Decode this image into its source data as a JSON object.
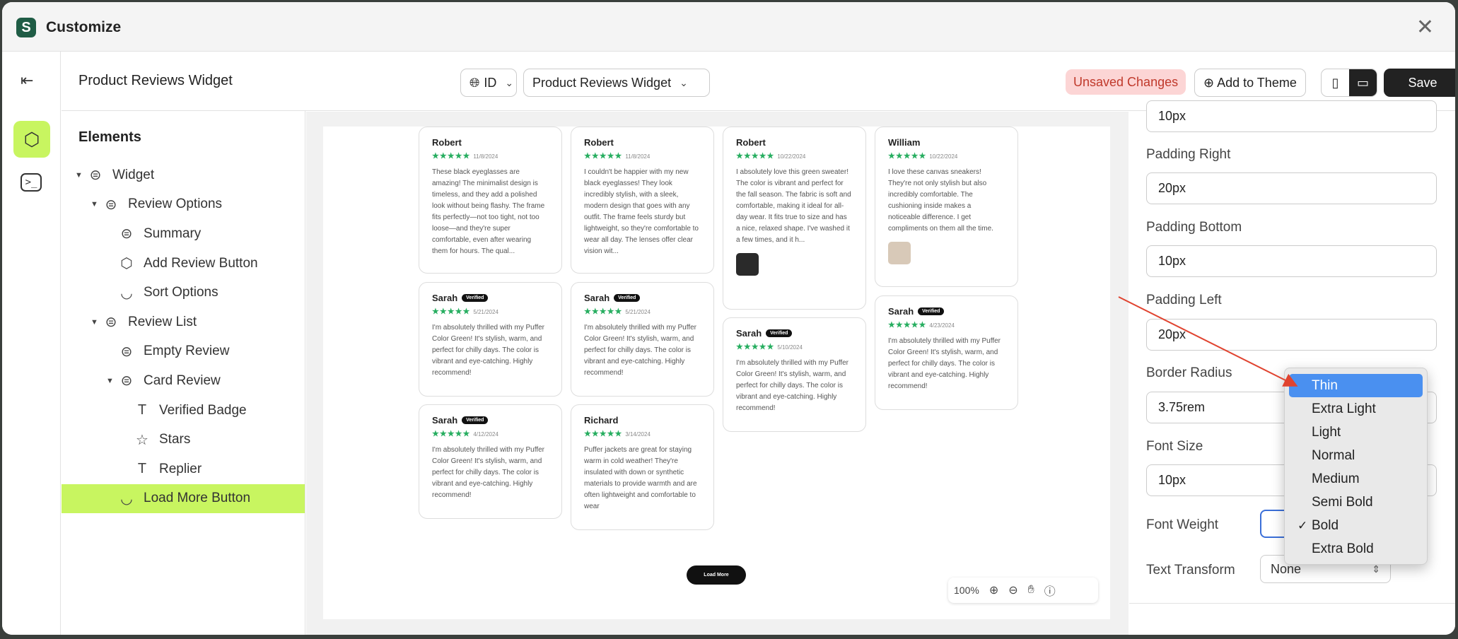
{
  "window": {
    "title": "Customize",
    "logo": "S"
  },
  "topbar": {
    "page_title": "Product Reviews Widget",
    "lang": "ID",
    "template": "Product Reviews Widget",
    "unsaved": "Unsaved Changes",
    "add_to_theme": "Add to Theme",
    "save": "Save"
  },
  "elements": {
    "heading": "Elements",
    "items": [
      {
        "label": "Widget"
      },
      {
        "label": "Review Options"
      },
      {
        "label": "Summary"
      },
      {
        "label": "Add Review Button"
      },
      {
        "label": "Sort Options"
      },
      {
        "label": "Review List"
      },
      {
        "label": "Empty Review"
      },
      {
        "label": "Card Review"
      },
      {
        "label": "Verified Badge"
      },
      {
        "label": "Stars"
      },
      {
        "label": "Replier"
      },
      {
        "label": "Load More Button"
      }
    ]
  },
  "canvas": {
    "verified": "Verified",
    "load_more": "Load More",
    "zoom": "100%",
    "cards": [
      {
        "name": "Robert",
        "date": "11/8/2024",
        "text": "These black eyeglasses are amazing! The minimalist design is timeless, and they add a polished look without being flashy. The frame fits perfectly—not too tight, not too loose—and they're super comfortable, even after wearing them for hours. The qual..."
      },
      {
        "name": "Robert",
        "date": "11/8/2024",
        "text": "I couldn't be happier with my new black eyeglasses! They look incredibly stylish, with a sleek, modern design that goes with any outfit. The frame feels sturdy but lightweight, so they're comfortable to wear all day. The lenses offer clear vision wit..."
      },
      {
        "name": "Robert",
        "date": "10/22/2024",
        "text": "I absolutely love this green sweater! The color is vibrant and perfect for the fall season. The fabric is soft and comfortable, making it ideal for all-day wear. It fits true to size and has a nice, relaxed shape. I've washed it a few times, and it h..."
      },
      {
        "name": "William",
        "date": "10/22/2024",
        "text": "I love these canvas sneakers! They're not only stylish but also incredibly comfortable. The cushioning inside makes a noticeable difference. I get compliments on them all the time."
      },
      {
        "name": "Sarah",
        "date": "5/21/2024",
        "text": "I'm absolutely thrilled with my Puffer Color Green! It's stylish, warm, and perfect for chilly days. The color is vibrant and eye-catching. Highly recommend!"
      },
      {
        "name": "Sarah",
        "date": "5/21/2024",
        "text": "I'm absolutely thrilled with my Puffer Color Green! It's stylish, warm, and perfect for chilly days. The color is vibrant and eye-catching. Highly recommend!"
      },
      {
        "name": "Sarah",
        "date": "5/10/2024",
        "text": "I'm absolutely thrilled with my Puffer Color Green! It's stylish, warm, and perfect for chilly days. The color is vibrant and eye-catching. Highly recommend!"
      },
      {
        "name": "Sarah",
        "date": "4/23/2024",
        "text": "I'm absolutely thrilled with my Puffer Color Green! It's stylish, warm, and perfect for chilly days. The color is vibrant and eye-catching. Highly recommend!"
      },
      {
        "name": "Sarah",
        "date": "4/12/2024",
        "text": "I'm absolutely thrilled with my Puffer Color Green! It's stylish, warm, and perfect for chilly days. The color is vibrant and eye-catching. Highly recommend!"
      },
      {
        "name": "Richard",
        "date": "3/14/2024",
        "text": "Puffer jackets are great for staying warm in cold weather! They're insulated with down or synthetic materials to provide warmth and are often lightweight and comfortable to wear"
      }
    ],
    "stars": "★★★★★"
  },
  "props": {
    "top_value": "10px",
    "padding_right": {
      "label": "Padding Right",
      "value": "20px"
    },
    "padding_bottom": {
      "label": "Padding Bottom",
      "value": "10px"
    },
    "padding_left": {
      "label": "Padding Left",
      "value": "20px"
    },
    "border_radius": {
      "label": "Border Radius",
      "value": "3.75rem"
    },
    "font_size": {
      "label": "Font Size",
      "value": "10px"
    },
    "font_weight": {
      "label": "Font Weight"
    },
    "text_transform": {
      "label": "Text Transform",
      "value": "None"
    }
  },
  "dropdown": {
    "options": [
      "Thin",
      "Extra Light",
      "Light",
      "Normal",
      "Medium",
      "Semi Bold",
      "Bold",
      "Extra Bold"
    ],
    "highlighted": "Thin",
    "checked": "Bold",
    "check_glyph": "✓"
  },
  "colors": {
    "accent": "#c8f560",
    "highlight": "#4a90f0",
    "arrow": "#e0432f",
    "stars": "#27ae60"
  }
}
